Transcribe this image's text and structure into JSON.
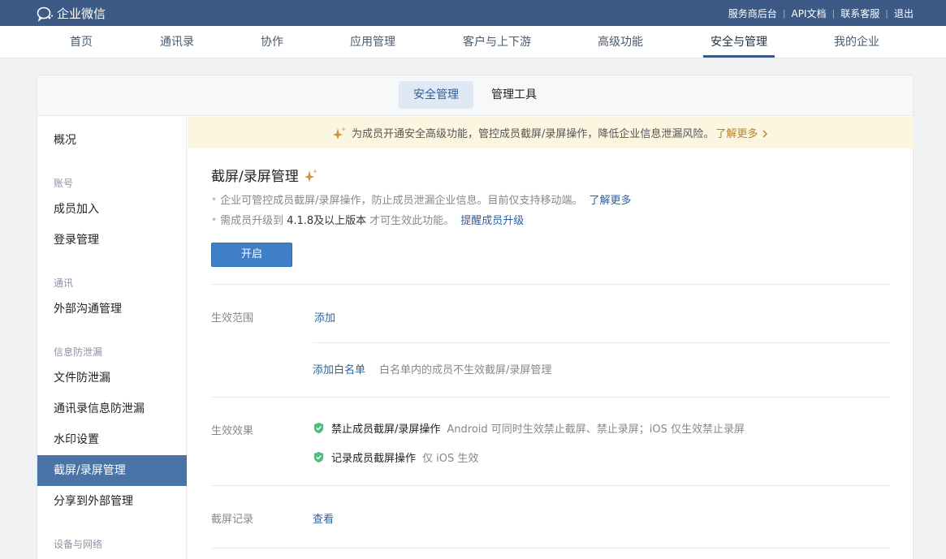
{
  "app": {
    "name": "企业微信"
  },
  "top_links": [
    "服务商后台",
    "API文档",
    "联系客服",
    "退出"
  ],
  "nav": {
    "items": [
      "首页",
      "通讯录",
      "协作",
      "应用管理",
      "客户与上下游",
      "高级功能",
      "安全与管理",
      "我的企业"
    ],
    "active_index": 6
  },
  "sub_tabs": {
    "items": [
      "安全管理",
      "管理工具"
    ],
    "active_index": 0
  },
  "sidebar": {
    "overview": "概况",
    "groups": [
      {
        "title": "账号",
        "items": [
          "成员加入",
          "登录管理"
        ]
      },
      {
        "title": "通讯",
        "items": [
          "外部沟通管理"
        ]
      },
      {
        "title": "信息防泄漏",
        "items": [
          "文件防泄漏",
          "通讯录信息防泄漏",
          "水印设置",
          "截屏/录屏管理",
          "分享到外部管理"
        ]
      },
      {
        "title": "设备与网络",
        "items": []
      }
    ],
    "active_item": "截屏/录屏管理"
  },
  "notice": {
    "text": "为成员开通安全高级功能，管控成员截屏/录屏操作，降低企业信息泄漏风险。",
    "link": "了解更多"
  },
  "content": {
    "title": "截屏/录屏管理",
    "desc1": {
      "text": "企业可管控成员截屏/录屏操作，防止成员泄漏企业信息。目前仅支持移动端。",
      "link": "了解更多"
    },
    "desc2": {
      "prefix": "需成员升级到",
      "version": "4.1.8及以上版本",
      "suffix": "才可生效此功能。",
      "link": "提醒成员升级"
    },
    "open_button": "开启",
    "scope": {
      "label": "生效范围",
      "add": "添加",
      "whitelist_add": "添加白名单",
      "whitelist_hint": "白名单内的成员不生效截屏/录屏管理"
    },
    "effect": {
      "label": "生效效果",
      "items": [
        {
          "text": "禁止成员截屏/录屏操作",
          "sub": "Android 可同时生效禁止截屏、禁止录屏；iOS 仅生效禁止录屏"
        },
        {
          "text": "记录成员截屏操作",
          "sub": "仅 iOS 生效"
        }
      ]
    },
    "record": {
      "label": "截屏记录",
      "view": "查看"
    }
  },
  "colors": {
    "topbar": "#3d5a87",
    "accent": "#2e5f9c",
    "active_sidebar": "#4a74a8",
    "check_green": "#4cbf7a",
    "notice_bg": "#fcf5e0"
  }
}
